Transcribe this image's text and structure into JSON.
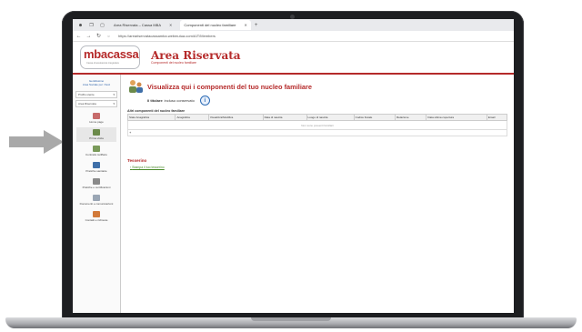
{
  "browser": {
    "tabs": [
      {
        "label": "Area Riservata – Cassa MBA",
        "active": false
      },
      {
        "label": "Componenti del nucleo familiare",
        "active": true
      }
    ],
    "url": "https://areariservatacassamba.webmutua.com/AIT/Members"
  },
  "header": {
    "logo": "mbacassa",
    "logo_sub": "Cassa di assistenza integrativa",
    "title": "Area Riservata",
    "subtitle": "Componenti del nucleo familiare"
  },
  "sidebar": {
    "user_name": "Gentilissimo",
    "user_sub": "Area Sociale per i Soci",
    "selects": [
      "Profilo utente",
      "Area Riservata"
    ],
    "items": [
      {
        "label": "Home page",
        "icon": "home-icon"
      },
      {
        "label": "Prima visita",
        "icon": "family-icon"
      },
      {
        "label": "Contratto tariffario",
        "icon": "document-icon"
      },
      {
        "label": "Pratiche sanitarie",
        "icon": "medical-icon"
      },
      {
        "label": "Pratiche e certificazioni",
        "icon": "certificate-icon"
      },
      {
        "label": "Documenti e comunicazioni",
        "icon": "folder-icon"
      },
      {
        "label": "Contatti e richieste",
        "icon": "contact-icon"
      }
    ]
  },
  "main": {
    "title": "Visualizza qui i componenti del tuo nucleo familiare",
    "holder_label": "Il titolare",
    "holder_value": "incluso conservato",
    "section_label": "Altri componenti del nucleo familiare",
    "columns": [
      "Stato Anagrafica",
      "Anagrafica",
      "Visualizza/Modifica",
      "Data di nascita",
      "Luogo di nascita",
      "Codice fiscale",
      "Relazione",
      "Data ultima copertura",
      "Email"
    ],
    "empty_text": "Non sono presenti familiari",
    "add_symbol": "+",
    "tesserino_title": "Tesserino",
    "tesserino_link": "Stampa il tuo tesserino"
  },
  "colors": {
    "brand": "#b52a2a",
    "link": "#4a8a2a"
  }
}
